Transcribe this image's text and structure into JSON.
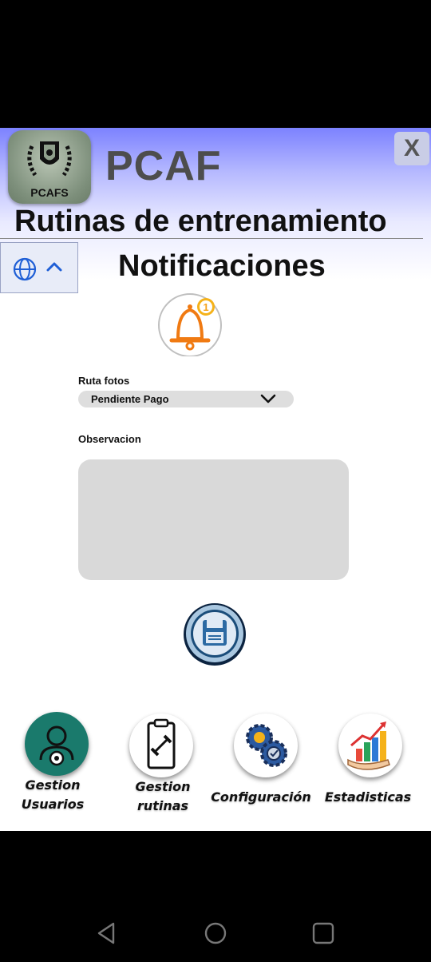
{
  "header": {
    "logo_text": "PCAFS",
    "app_name": "PCAF",
    "close_label": "X",
    "page_title": "Rutinas de entrenamiento"
  },
  "section": {
    "title": "Notificaciones",
    "notification_count": "1"
  },
  "form": {
    "ruta_label": "Ruta fotos",
    "ruta_value": "Pendiente Pago",
    "observacion_label": "Observacion",
    "observacion_value": ""
  },
  "nav": [
    {
      "label_line1": "Gestion",
      "label_line2": "Usuarios",
      "icon": "user-gear-icon"
    },
    {
      "label_line1": "Gestion",
      "label_line2": "rutinas",
      "icon": "clipboard-dumbbell-icon"
    },
    {
      "label_line1": "Configuración",
      "label_line2": "",
      "icon": "gears-icon"
    },
    {
      "label_line1": "Estadisticas",
      "label_line2": "",
      "icon": "bar-chart-icon"
    }
  ],
  "colors": {
    "header_gradient_top": "#7c82ff",
    "bell_orange": "#f07a12",
    "teal": "#1a7a6c",
    "field_gray": "#d9d9d9"
  }
}
